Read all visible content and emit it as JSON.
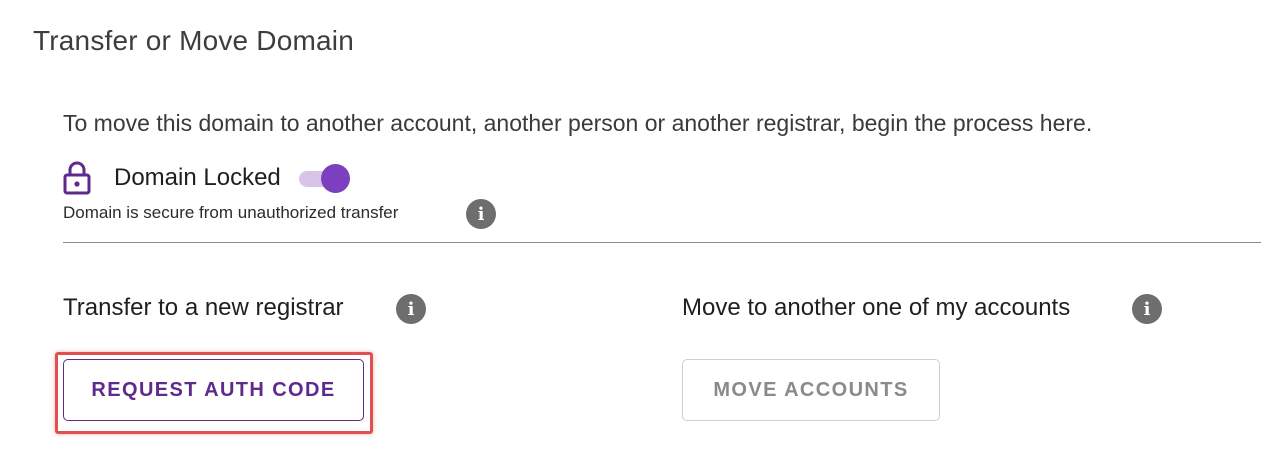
{
  "page": {
    "title": "Transfer or Move Domain",
    "intro": "To move this domain to another account, another person or another registrar, begin the process here."
  },
  "lock": {
    "icon": "padlock-icon",
    "label": "Domain Locked",
    "toggle_state": "on",
    "description": "Domain is secure from unauthorized transfer",
    "info_glyph": "i"
  },
  "transfer": {
    "label": "Transfer to a new registrar",
    "info_glyph": "i",
    "button_label": "REQUEST AUTH CODE"
  },
  "move": {
    "label": "Move to another one of my accounts",
    "info_glyph": "i",
    "button_label": "MOVE ACCOUNTS"
  },
  "colors": {
    "accent": "#7b3fbf",
    "primary_button_text": "#5e2a8c",
    "highlight": "#e05050",
    "info_icon": "#6e6e6e"
  }
}
